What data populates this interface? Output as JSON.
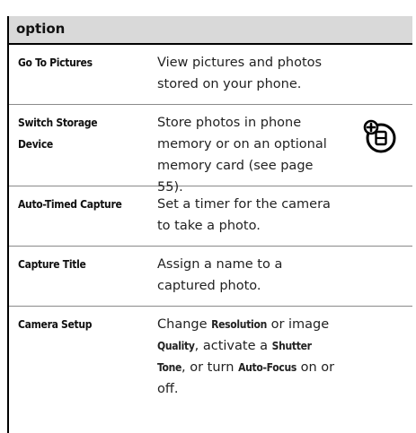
{
  "table": {
    "header": "option",
    "rows": [
      {
        "option": "Go To Pictures",
        "description": "View pictures and photos stored on your phone."
      },
      {
        "option_line1": "Switch Storage",
        "option_line2": "Device",
        "description": "Store photos in phone memory or on an optional memory card (see page 55)."
      },
      {
        "option": "Auto-Timed Capture",
        "description": "Set a timer for the camera to take a photo."
      },
      {
        "option": "Capture Title",
        "description": "Assign a name to a captured photo."
      },
      {
        "option": "Camera Setup",
        "desc_parts": [
          "Change ",
          "Resolution",
          " or image ",
          "Quality",
          ", activate a ",
          "Shutter Tone",
          ", or turn ",
          "Auto-Focus",
          " on or off."
        ]
      }
    ]
  },
  "icon": "memory-card-feature-icon"
}
